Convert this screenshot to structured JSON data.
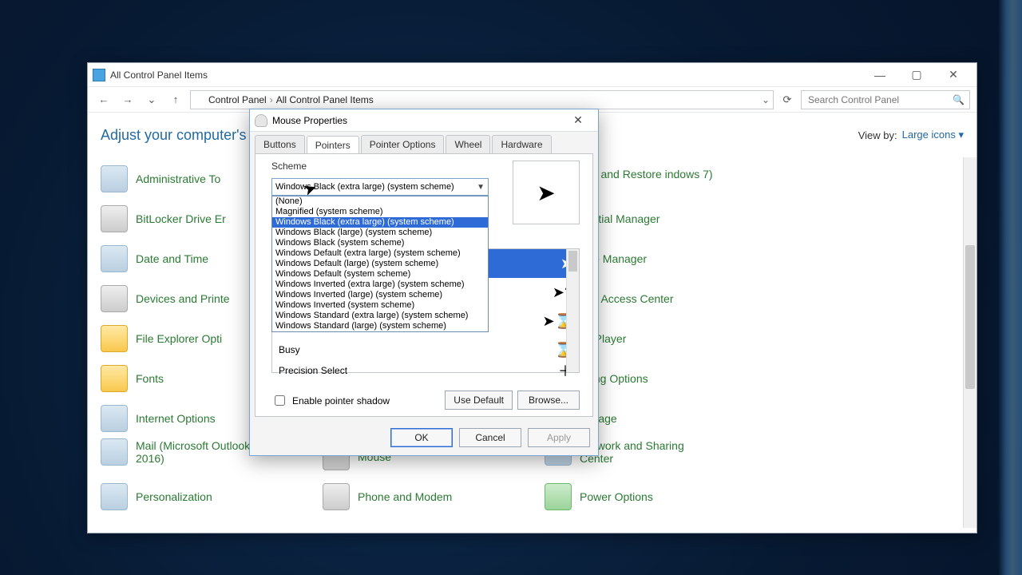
{
  "explorer": {
    "title": "All Control Panel Items",
    "breadcrumb": [
      "Control Panel",
      "All Control Panel Items"
    ],
    "search_placeholder": "Search Control Panel",
    "heading": "Adjust your computer's s",
    "view_by_label": "View by:",
    "view_by_value": "Large icons",
    "items_col1": [
      "Administrative To",
      "BitLocker Drive Er",
      "Date and Time",
      "Devices and Printe",
      "File Explorer Opti",
      "Fonts",
      "Internet Options",
      "Mail (Microsoft Outlook 2016)",
      "Personalization"
    ],
    "items_col2": [
      "Mouse",
      "Phone and Modem"
    ],
    "items_col3": [
      "kup and Restore indows 7)",
      "dential Manager",
      "vice Manager",
      "e of Access Center",
      "sh Player",
      "exing Options",
      "nguage",
      "Network and Sharing Center",
      "Power Options"
    ]
  },
  "dialog": {
    "title": "Mouse Properties",
    "tabs": [
      "Buttons",
      "Pointers",
      "Pointer Options",
      "Wheel",
      "Hardware"
    ],
    "active_tab": "Pointers",
    "scheme_label": "Scheme",
    "scheme_selected": "Windows Black (extra large) (system scheme)",
    "scheme_options": [
      "(None)",
      "Magnified (system scheme)",
      "Windows Black (extra large) (system scheme)",
      "Windows Black (large) (system scheme)",
      "Windows Black (system scheme)",
      "Windows Default (extra large) (system scheme)",
      "Windows Default (large) (system scheme)",
      "Windows Default (system scheme)",
      "Windows Inverted (extra large) (system scheme)",
      "Windows Inverted (large) (system scheme)",
      "Windows Inverted (system scheme)",
      "Windows Standard (extra large) (system scheme)",
      "Windows Standard (large) (system scheme)"
    ],
    "scheme_highlight_index": 2,
    "busy_label": "Busy",
    "precision_label": "Precision Select",
    "shadow_label": "Enable pointer shadow",
    "use_default": "Use Default",
    "browse": "Browse...",
    "ok": "OK",
    "cancel": "Cancel",
    "apply": "Apply"
  }
}
